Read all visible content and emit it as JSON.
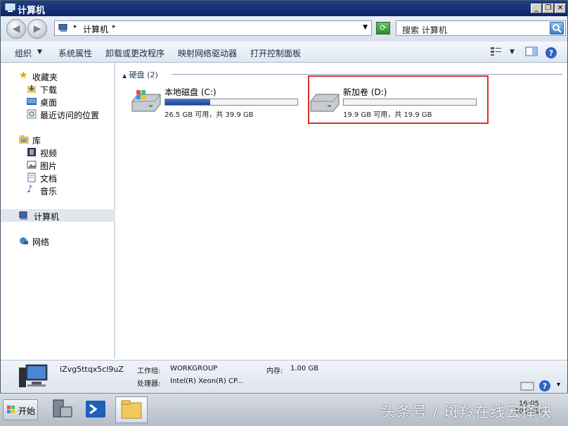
{
  "window": {
    "title": "计算机",
    "title_buttons": [
      "_",
      "❐",
      "✕"
    ]
  },
  "address": {
    "crumb": "计算机",
    "search_placeholder": "搜索 计算机"
  },
  "toolbar": {
    "organize": "组织",
    "system_props": "系统属性",
    "uninstall": "卸载或更改程序",
    "map_drive": "映射网络驱动器",
    "control_panel": "打开控制面板"
  },
  "nav": {
    "favorites": "收藏夹",
    "downloads": "下载",
    "desktop": "桌面",
    "recent": "最近访问的位置",
    "libraries": "库",
    "videos": "视频",
    "pictures": "图片",
    "documents": "文档",
    "music": "音乐",
    "computer": "计算机",
    "network": "网络"
  },
  "main": {
    "group_header": "硬盘 (2)",
    "drives": [
      {
        "name": "本地磁盘 (C:)",
        "info": "26.5 GB 可用，共 39.9 GB",
        "used_fraction": 0.34
      },
      {
        "name": "新加卷 (D:)",
        "info": "19.9 GB 可用，共 19.9 GB",
        "used_fraction": 0.0
      }
    ]
  },
  "details": {
    "computer_name": "iZvg5ttqx5cl9uZ",
    "workgroup_label": "工作组:",
    "workgroup": "WORKGROUP",
    "memory_label": "内存:",
    "memory": "1.00 GB",
    "cpu_label": "处理器:",
    "cpu": "Intel(R) Xeon(R) CP..."
  },
  "taskbar": {
    "start": "开始",
    "time": "16:05",
    "date": "2019/1/..."
  },
  "watermark": "头条号 / 斑羚在线云择快",
  "colors": {
    "title_bg": "#0c2468",
    "highlight_border": "#d9302e",
    "used_bar": "#1d3f96"
  }
}
